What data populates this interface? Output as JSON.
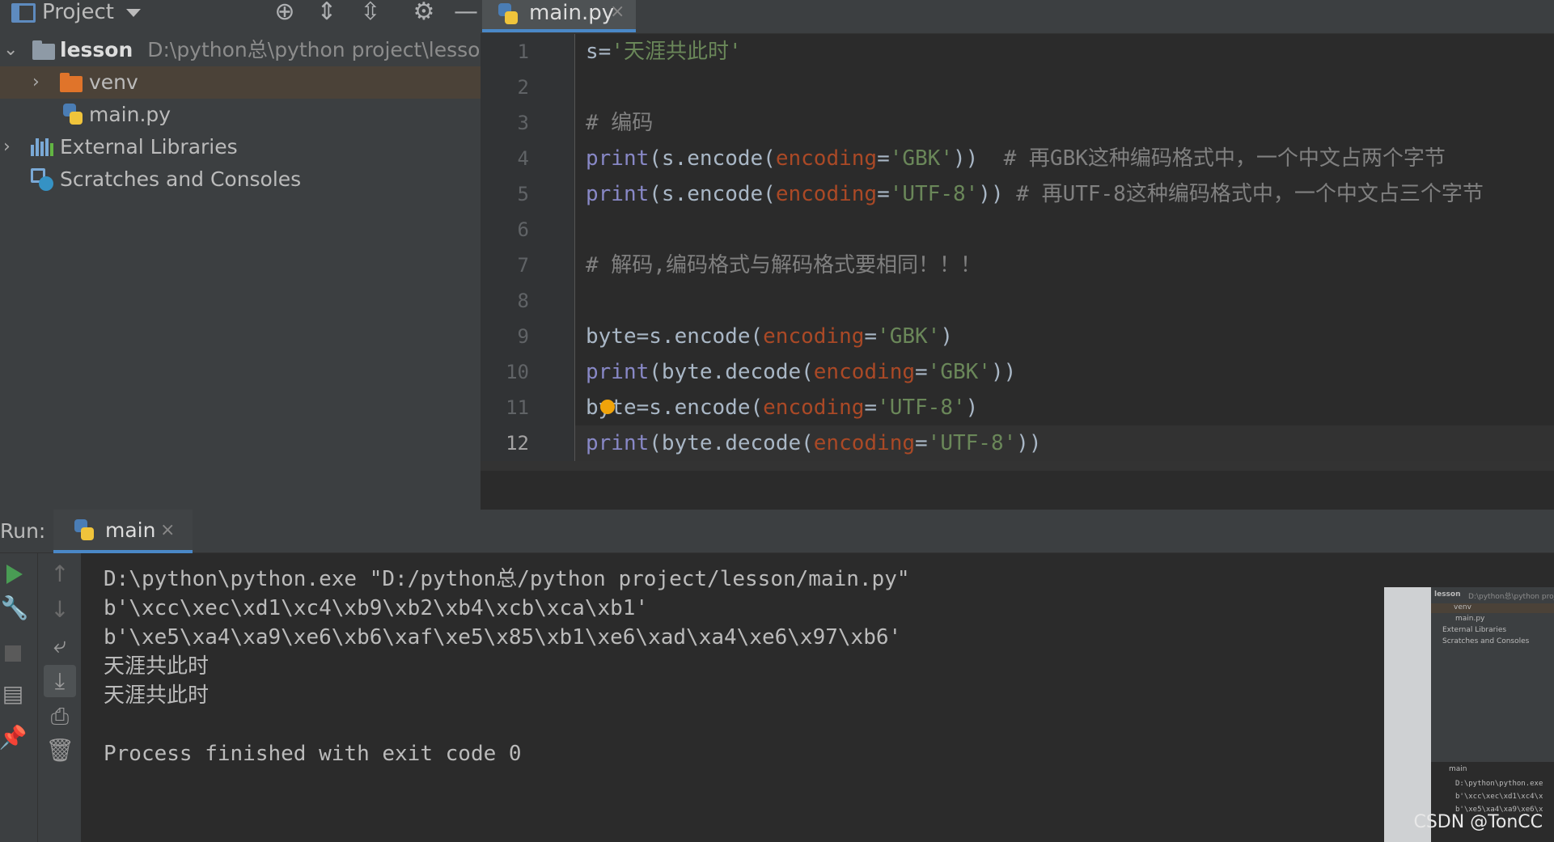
{
  "project_panel": {
    "title": "Project",
    "toolbar_icons": [
      "locate-icon",
      "expand-all-icon",
      "collapse-all-icon",
      "gear-icon",
      "minimize-icon"
    ],
    "tree": [
      {
        "name": "lesson",
        "path": "D:\\python总\\python project\\lesson"
      },
      {
        "name": "venv"
      },
      {
        "name": "main.py"
      },
      {
        "name": "External Libraries"
      },
      {
        "name": "Scratches and Consoles"
      }
    ]
  },
  "editor": {
    "tab": {
      "label": "main.py",
      "close": "×"
    },
    "line_numbers": [
      "1",
      "2",
      "3",
      "4",
      "5",
      "6",
      "7",
      "8",
      "9",
      "10",
      "11",
      "12"
    ],
    "current_line": 12,
    "lines": [
      [
        {
          "t": "plain",
          "v": "s="
        },
        {
          "t": "str",
          "v": "'天涯共此时'"
        }
      ],
      [],
      [
        {
          "t": "cm",
          "v": "# 编码"
        }
      ],
      [
        {
          "t": "fn",
          "v": "print"
        },
        {
          "t": "plain",
          "v": "(s.encode("
        },
        {
          "t": "kw",
          "v": "encoding"
        },
        {
          "t": "plain",
          "v": "="
        },
        {
          "t": "str",
          "v": "'GBK'"
        },
        {
          "t": "plain",
          "v": "))  "
        },
        {
          "t": "cm",
          "v": "# 再GBK这种编码格式中，一个中文占两个字节"
        }
      ],
      [
        {
          "t": "fn",
          "v": "print"
        },
        {
          "t": "plain",
          "v": "(s.encode("
        },
        {
          "t": "kw",
          "v": "encoding"
        },
        {
          "t": "plain",
          "v": "="
        },
        {
          "t": "str",
          "v": "'UTF-8'"
        },
        {
          "t": "plain",
          "v": ")) "
        },
        {
          "t": "cm",
          "v": "# 再UTF-8这种编码格式中，一个中文占三个字节"
        }
      ],
      [],
      [
        {
          "t": "cm",
          "v": "# 解码,编码格式与解码格式要相同！！！"
        }
      ],
      [],
      [
        {
          "t": "plain",
          "v": "byte=s.encode("
        },
        {
          "t": "kw",
          "v": "encoding"
        },
        {
          "t": "plain",
          "v": "="
        },
        {
          "t": "str",
          "v": "'GBK'"
        },
        {
          "t": "plain",
          "v": ")"
        }
      ],
      [
        {
          "t": "fn",
          "v": "print"
        },
        {
          "t": "plain",
          "v": "(byte.decode("
        },
        {
          "t": "kw",
          "v": "encoding"
        },
        {
          "t": "plain",
          "v": "="
        },
        {
          "t": "str",
          "v": "'GBK'"
        },
        {
          "t": "plain",
          "v": "))"
        }
      ],
      [
        {
          "t": "plain",
          "v": "byte=s.encode("
        },
        {
          "t": "kw",
          "v": "encoding"
        },
        {
          "t": "plain",
          "v": "="
        },
        {
          "t": "str",
          "v": "'UTF-8'"
        },
        {
          "t": "plain",
          "v": ")"
        }
      ],
      [
        {
          "t": "fn",
          "v": "print"
        },
        {
          "t": "plain",
          "v": "(byte.decode("
        },
        {
          "t": "kw",
          "v": "encoding"
        },
        {
          "t": "plain",
          "v": "="
        },
        {
          "t": "str",
          "v": "'UTF-8'"
        },
        {
          "t": "plain",
          "v": "))"
        }
      ]
    ]
  },
  "run_panel": {
    "label": "Run:",
    "tab": {
      "label": "main",
      "close": "×"
    },
    "toolbar_icons": [
      "run-icon",
      "up-arrow-icon",
      "wrench-icon",
      "down-arrow-icon",
      "stop-icon",
      "soft-wrap-icon",
      "layout-icon",
      "scroll-to-end-icon",
      "print-icon",
      "pin-icon",
      "trash-icon"
    ],
    "output": [
      "D:\\python\\python.exe \"D:/python总/python project/lesson/main.py\"",
      "b'\\xcc\\xec\\xd1\\xc4\\xb9\\xb2\\xb4\\xcb\\xca\\xb1'",
      "b'\\xe5\\xa4\\xa9\\xe6\\xb6\\xaf\\xe5\\x85\\xb1\\xe6\\xad\\xa4\\xe6\\x97\\xb6'",
      "天涯共此时",
      "天涯共此时",
      "",
      "Process finished with exit code 0"
    ]
  },
  "thumbnail": {
    "tree": [
      "lesson",
      "D:\\python总\\python proj",
      "venv",
      "main.py",
      "External Libraries",
      "Scratches and Consoles"
    ],
    "run_tab": "main",
    "output": [
      "D:\\python\\python.exe",
      "b'\\xcc\\xec\\xd1\\xc4\\x",
      "b'\\xe5\\xa4\\xa9\\xe6\\x"
    ]
  },
  "watermark": "CSDN @TonCC",
  "colors": {
    "keyword_fn": "#8888c6",
    "string": "#6a8759",
    "param": "#aa4926",
    "comment": "#808080",
    "accent": "#4a88c7"
  }
}
